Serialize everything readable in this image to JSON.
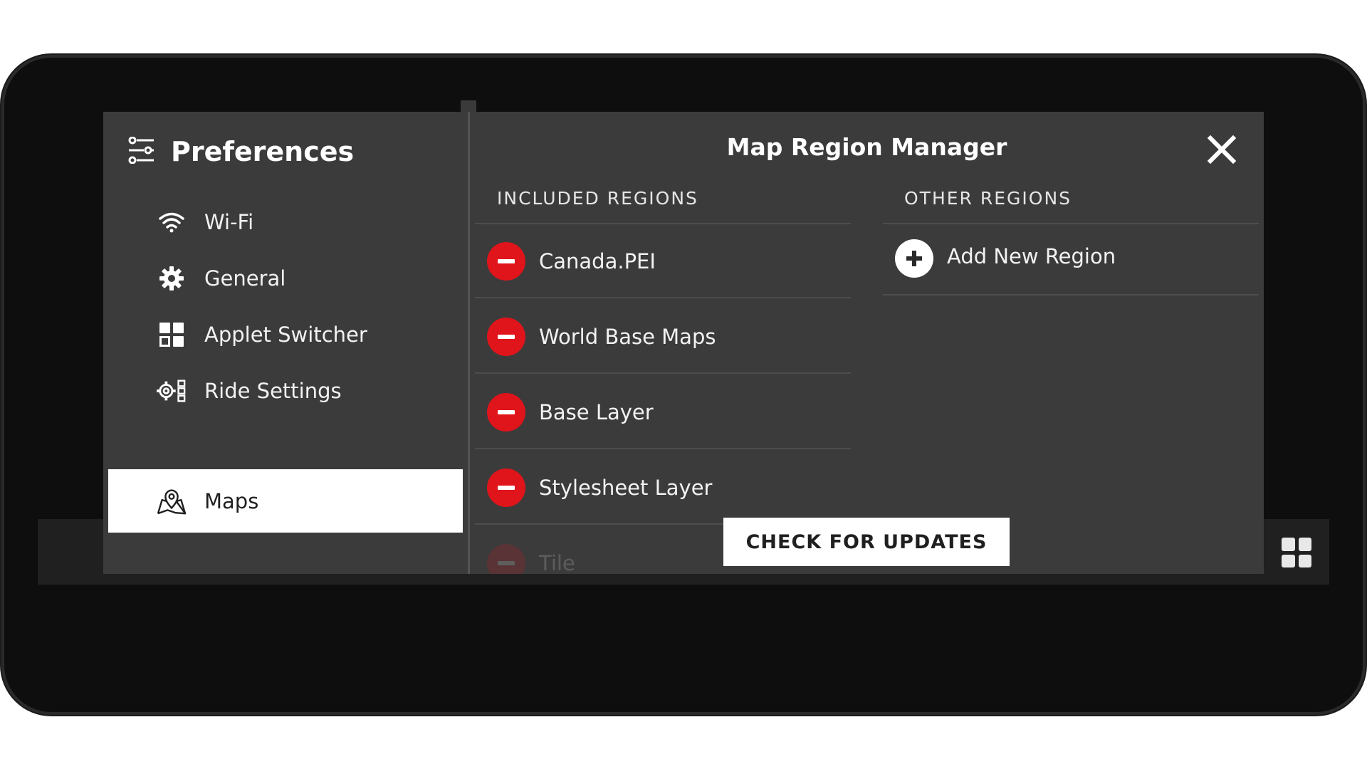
{
  "sidebar": {
    "title": "Preferences",
    "header_icon": "preferences-sliders-icon",
    "items": [
      {
        "label": "Wi-Fi",
        "icon": "wifi-icon"
      },
      {
        "label": "General",
        "icon": "gear-icon"
      },
      {
        "label": "Applet Switcher",
        "icon": "applet-grid-icon"
      },
      {
        "label": "Ride Settings",
        "icon": "ride-settings-icon"
      },
      {
        "label": "Maps",
        "icon": "map-pin-icon",
        "active": true
      }
    ]
  },
  "main": {
    "title": "Map Region Manager",
    "close_icon": "close-icon",
    "included_header": "INCLUDED REGIONS",
    "other_header": "OTHER REGIONS",
    "included_regions": [
      {
        "name": "Canada.PEI"
      },
      {
        "name": "World Base Maps"
      },
      {
        "name": "Base Layer"
      },
      {
        "name": "Stylesheet Layer"
      },
      {
        "name": "Tile"
      }
    ],
    "add_label": "Add New Region",
    "check_button": "CHECK FOR UPDATES"
  },
  "colors": {
    "remove_red": "#e0141b",
    "panel_bg": "#3b3b3b",
    "device_bg": "#0e0e0e"
  }
}
